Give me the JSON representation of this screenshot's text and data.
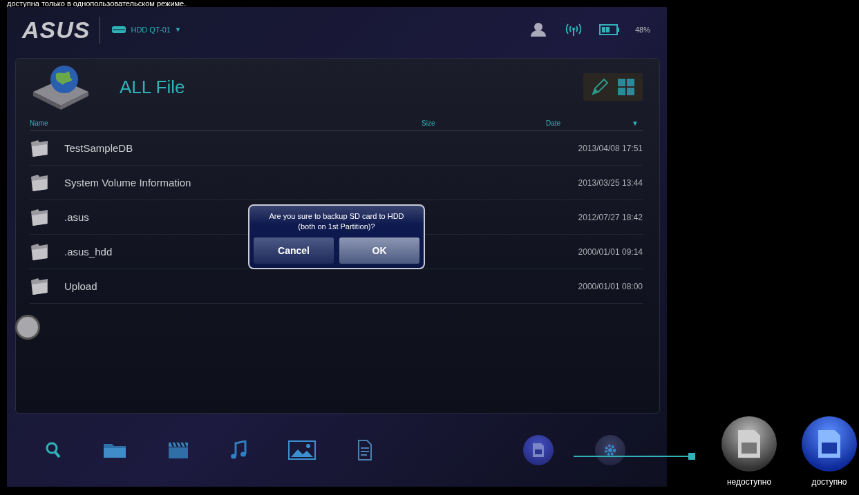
{
  "caption": "доступна только в однопользовательском режиме.",
  "header": {
    "logo": "ASUS",
    "device": "HDD QT-01",
    "device_caret": "▼",
    "battery_text": "48%"
  },
  "panel": {
    "title": "ALL File",
    "columns": [
      {
        "label": "Name"
      },
      {
        "label": "Size"
      },
      {
        "label": "Date",
        "sort": "▼"
      }
    ],
    "rows": [
      {
        "name": "TestSampleDB",
        "date": "2013/04/08 17:51"
      },
      {
        "name": "System Volume Information",
        "date": "2013/03/25 13:44"
      },
      {
        "name": ".asus",
        "date": "2012/07/27 18:42"
      },
      {
        "name": ".asus_hdd",
        "date": "2000/01/01 09:14"
      },
      {
        "name": "Upload",
        "date": "2000/01/01 08:00"
      }
    ]
  },
  "dialog": {
    "message": "Are you sure to backup SD card to HDD (both on 1st Partition)?",
    "buttons": [
      {
        "label": "Cancel",
        "kind": "cancel"
      },
      {
        "label": "OK",
        "kind": "ok"
      }
    ]
  },
  "toolbar": [
    {
      "kind": "search"
    },
    {
      "kind": "folder"
    },
    {
      "kind": "video"
    },
    {
      "kind": "music"
    },
    {
      "kind": "image"
    },
    {
      "kind": "document"
    },
    {
      "kind": "sd"
    },
    {
      "kind": "settings"
    }
  ],
  "legend": [
    {
      "label": "недоступно",
      "available": false
    },
    {
      "label": "доступно",
      "available": true
    }
  ]
}
